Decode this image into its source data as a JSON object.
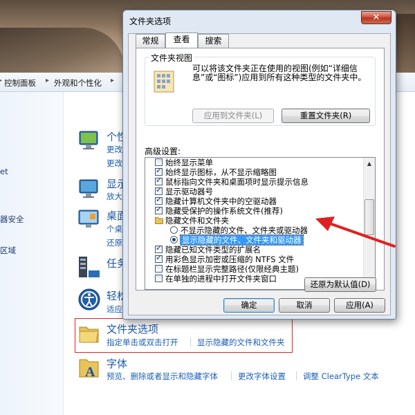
{
  "dialog": {
    "title": "文件夹选项",
    "close_glyph": "✕",
    "tabs": [
      {
        "label": "常规"
      },
      {
        "label": "查看"
      },
      {
        "label": "搜索"
      }
    ],
    "folder_views": {
      "label": "文件夹视图",
      "description": "可以将该文件夹正在使用的视图(例如“详细信息”或“图标”)应用到所有这种类型的文件夹中。",
      "apply_button": "应用到文件夹(L)",
      "reset_button": "重置文件夹(R)"
    },
    "advanced": {
      "label": "高级设置:",
      "items": [
        {
          "text": "始终显示菜单",
          "kind": "checkbox",
          "checked": false
        },
        {
          "text": "始终显示图标，从不显示缩略图",
          "kind": "checkbox",
          "checked": true
        },
        {
          "text": "鼠标指向文件夹和桌面项时显示提示信息",
          "kind": "checkbox",
          "checked": true
        },
        {
          "text": "显示驱动器号",
          "kind": "checkbox",
          "checked": true
        },
        {
          "text": "隐藏计算机文件夹中的空驱动器",
          "kind": "checkbox",
          "checked": true
        },
        {
          "text": "隐藏受保护的操作系统文件(推荐)",
          "kind": "checkbox",
          "checked": true
        },
        {
          "text": "隐藏文件和文件夹",
          "kind": "folder"
        },
        {
          "text": "不显示隐藏的文件、文件夹或驱动器",
          "kind": "radio",
          "checked": false
        },
        {
          "text": "显示隐藏的文件、文件夹和驱动器",
          "kind": "radio",
          "checked": true
        },
        {
          "text": "隐藏已知文件类型的扩展名",
          "kind": "checkbox",
          "checked": true
        },
        {
          "text": "用彩色显示加密或压缩的 NTFS 文件",
          "kind": "checkbox",
          "checked": true
        },
        {
          "text": "在标题栏显示完整路径(仅限经典主题)",
          "kind": "checkbox",
          "checked": false
        },
        {
          "text": "在单独的进程中打开文件夹窗口",
          "kind": "checkbox",
          "checked": false
        }
      ]
    },
    "restore_defaults": "还原为默认值(D)",
    "ok": "确定",
    "cancel": "取消",
    "apply": "应用(A)"
  },
  "control_panel": {
    "breadcrumb": [
      "控制面板",
      "外观和个性化"
    ],
    "left_fragments": [
      "et",
      "器安全",
      "区域"
    ],
    "items": [
      {
        "title": "个性",
        "links": [
          "更改",
          "更改"
        ]
      },
      {
        "title": "显示",
        "links": [
          "放大"
        ]
      },
      {
        "title": "桌面",
        "links": [
          "个桌",
          "还原"
        ]
      },
      {
        "title": "任务",
        "links": []
      },
      {
        "title": "轻松",
        "links": [
          "适应"
        ]
      },
      {
        "title": "文件夹选项",
        "links": [
          "指定单击或双击打开",
          "显示隐藏的文件和文件夹"
        ]
      },
      {
        "title": "字体",
        "links": [
          "预览、删除或者显示和隐藏字体",
          "更改字体设置",
          "调整 ClearType 文本"
        ]
      }
    ]
  },
  "colors": {
    "selection": "#3399ff",
    "annotation": "#e02020",
    "link": "#1b5fb8"
  }
}
